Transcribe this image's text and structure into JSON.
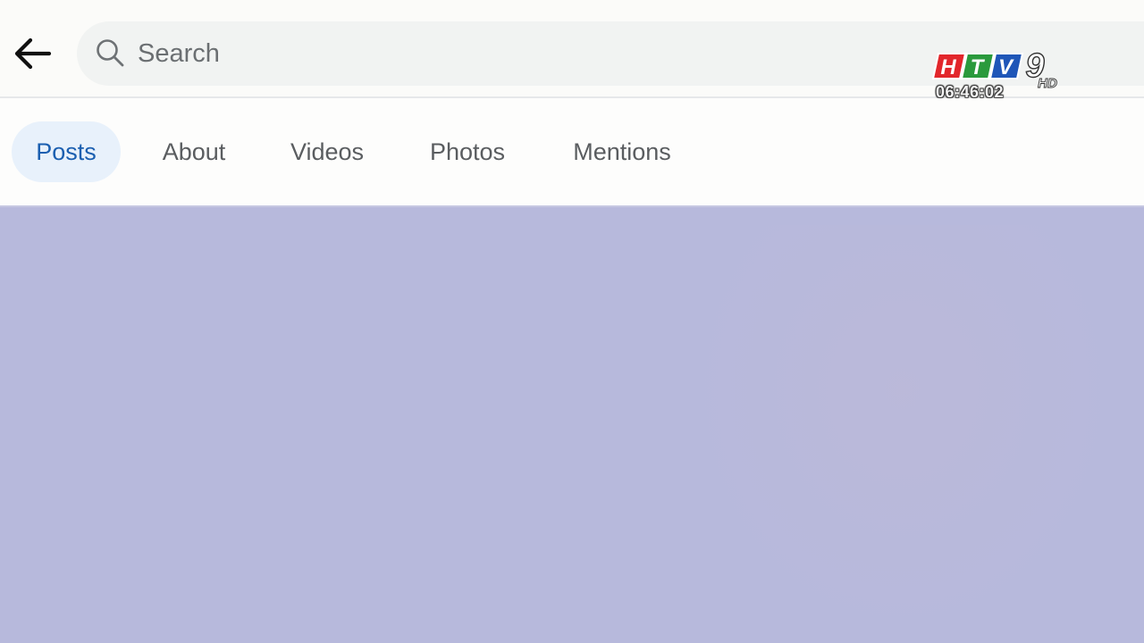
{
  "header": {
    "back_icon": "arrow-left-icon",
    "search": {
      "icon": "search-icon",
      "placeholder": "Search",
      "value": ""
    }
  },
  "watermark": {
    "logo_text": "HTV9 HD",
    "clock": "06:46:02"
  },
  "tabs": [
    {
      "label": "Posts",
      "active": true
    },
    {
      "label": "About",
      "active": false
    },
    {
      "label": "Videos",
      "active": false
    },
    {
      "label": "Photos",
      "active": false
    },
    {
      "label": "Mentions",
      "active": false
    }
  ],
  "colors": {
    "accent": "#1b5fb0",
    "active_tab_bg": "#e8f1fb",
    "content_bg": "#b7b9dc"
  }
}
